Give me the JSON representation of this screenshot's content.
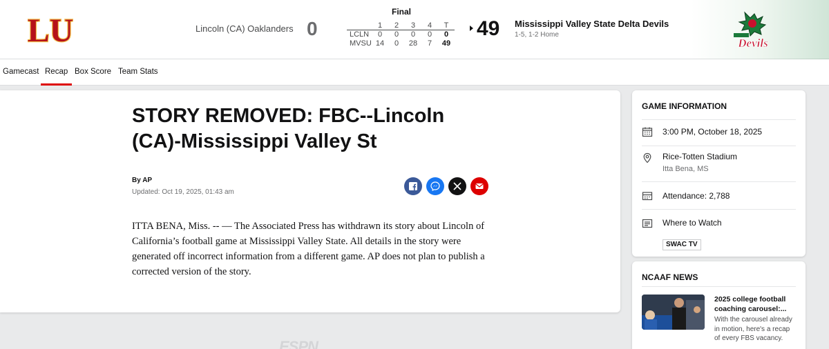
{
  "scoreboard": {
    "status": "Final",
    "away": {
      "name": "Lincoln (CA) Oaklanders",
      "abbr": "LCLN",
      "score": "0",
      "logo_letters": "LU",
      "logo_color": "#b5121b"
    },
    "home": {
      "name": "Mississippi Valley State Delta Devils",
      "abbr": "MVSU",
      "score": "49",
      "record": "1-5, 1-2 Home",
      "logo_color": "#1b7a3a",
      "logo_text": "Devils"
    },
    "periods": [
      "1",
      "2",
      "3",
      "4",
      "T"
    ],
    "linescore": [
      {
        "team": "LCLN",
        "q": [
          "0",
          "0",
          "0",
          "0"
        ],
        "total": "0"
      },
      {
        "team": "MVSU",
        "q": [
          "14",
          "0",
          "28",
          "7"
        ],
        "total": "49"
      }
    ]
  },
  "nav": {
    "tabs": [
      "Gamecast",
      "Recap",
      "Box Score",
      "Team Stats"
    ],
    "active": "Recap"
  },
  "article": {
    "headline": "STORY REMOVED: FBC--Lincoln (CA)-Mississippi Valley St",
    "byline": "By AP",
    "updated": "Updated: Oct 19, 2025, 01:43 am",
    "body": "ITTA BENA, Miss. -- — The Associated Press has withdrawn its story about Lincoln of California’s football game at Mississippi Valley State. All details in the story were generated off incorrect information from a different game. AP does not plan to publish a corrected version of the story."
  },
  "share": [
    "facebook-icon",
    "messenger-icon",
    "x-icon",
    "email-icon"
  ],
  "watermark": "ESPN",
  "game_info": {
    "title": "GAME INFORMATION",
    "datetime": "3:00 PM, October 18, 2025",
    "venue": "Rice-Totten Stadium",
    "location": "Itta Bena, MS",
    "attendance": "Attendance: 2,788",
    "where_to_watch": "Where to Watch",
    "network": "SWAC TV"
  },
  "news": {
    "title": "NCAAF NEWS",
    "items": [
      {
        "headline": "2025 college football coaching carousel:...",
        "description": "With the carousel already in motion, here's a recap of every FBS vacancy."
      }
    ]
  },
  "colors": {
    "accent": "#dd0000",
    "text": "#121213",
    "muted": "#6c6d6f",
    "background": "#e9eaeb"
  }
}
